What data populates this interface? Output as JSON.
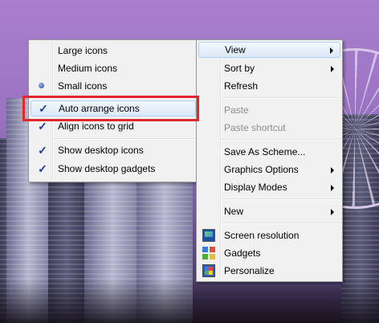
{
  "submenu": {
    "items": [
      {
        "label": "Large icons"
      },
      {
        "label": "Medium icons"
      },
      {
        "label": "Small icons",
        "selected": true
      },
      {
        "label": "Auto arrange icons",
        "checked": true
      },
      {
        "label": "Align icons to grid",
        "checked": true
      },
      {
        "label": "Show desktop icons",
        "checked": true
      },
      {
        "label": "Show desktop gadgets",
        "checked": true
      }
    ]
  },
  "context_menu": {
    "items": [
      {
        "label": "View",
        "has_submenu": true,
        "highlighted": true
      },
      {
        "label": "Sort by",
        "has_submenu": true
      },
      {
        "label": "Refresh"
      },
      {
        "label": "Paste",
        "disabled": true
      },
      {
        "label": "Paste shortcut",
        "disabled": true
      },
      {
        "label": "Save As Scheme..."
      },
      {
        "label": "Graphics Options",
        "has_submenu": true
      },
      {
        "label": "Display Modes",
        "has_submenu": true
      },
      {
        "label": "New",
        "has_submenu": true
      },
      {
        "label": "Screen resolution",
        "icon": "screen-resolution-icon"
      },
      {
        "label": "Gadgets",
        "icon": "gadgets-icon"
      },
      {
        "label": "Personalize",
        "icon": "personalize-icon"
      }
    ]
  },
  "colors": {
    "highlight_box": "#e0262f",
    "menu_background": "#f1f1f1",
    "hover_border": "#aecff7"
  }
}
